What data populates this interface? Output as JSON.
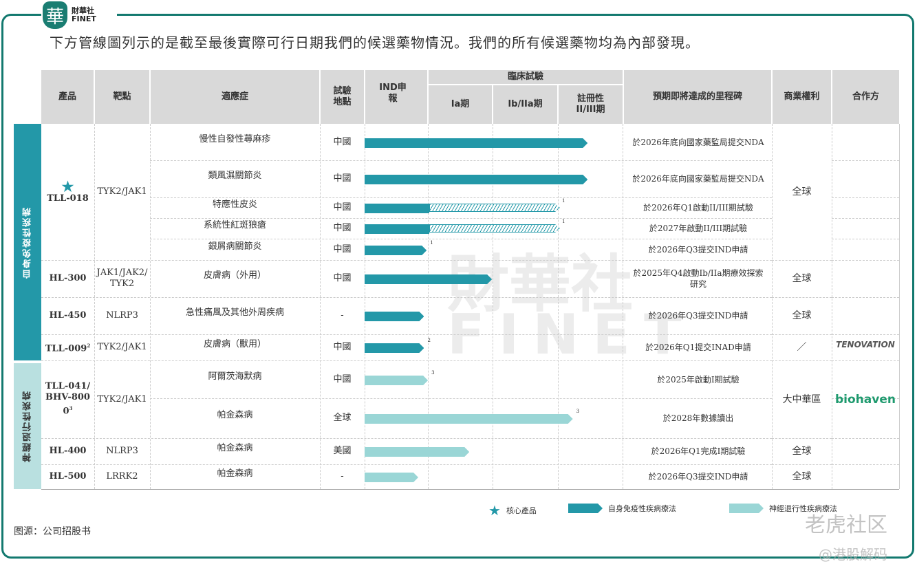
{
  "brand": {
    "logo_char": "華",
    "name": "財華社",
    "sub": "FINET"
  },
  "intro": "下方管線圖列示的是截至最後實際可行日期我們的候選藥物情況。我們的所有候選藥物均為內部發現。",
  "header": {
    "product": "產品",
    "target": "靶點",
    "indication": "適應症",
    "site": "試驗地點",
    "ind": "IND申報",
    "clinical": "臨床試驗",
    "ia": "Ia期",
    "ib": "Ib/IIa期",
    "reg": "註冊性II/III期",
    "milestone": "預期即將達成的里程碑",
    "rights": "商業權利",
    "partner": "合作方"
  },
  "colors": {
    "autoimmune": "#2398a8",
    "neuro": "#9ad6d6"
  },
  "categories": [
    {
      "label": "自身免疫性疾病"
    },
    {
      "label": "神經退行性疾病"
    }
  ],
  "products": [
    {
      "name": "TLL-018",
      "target": "TYK2/JAK1",
      "core": true
    },
    {
      "name": "HL-300",
      "target": "JAK1/JAK2/ TYK2"
    },
    {
      "name": "HL-450",
      "target": "NLRP3"
    },
    {
      "name": "TLL-009",
      "sup": "2",
      "target": "TYK2/JAK1"
    },
    {
      "name": "TLL-041/BHV-8000",
      "sup": "3",
      "target": "TYK2/JAK1"
    },
    {
      "name": "HL-400",
      "target": "NLRP3"
    },
    {
      "name": "HL-500",
      "target": "LRRK2"
    }
  ],
  "rows": [
    {
      "indication": "慢性自發性蕁麻疹",
      "site": "中國",
      "progress_phases": 3.45,
      "type": "auto",
      "milestone": "於2026年底向國家藥監局提交NDA"
    },
    {
      "indication": "類風濕關節炎",
      "site": "中國",
      "progress_phases": 3.45,
      "type": "auto",
      "milestone": "於2026年底向國家藥監局提交NDA"
    },
    {
      "indication": "特應性皮炎",
      "site": "中國",
      "progress_phases": 1.0,
      "planned_to": 3.0,
      "type": "auto",
      "note": "1",
      "milestone": "於2026年Q1啟動II/III期試驗"
    },
    {
      "indication": "系統性紅斑狼瘡",
      "site": "中國",
      "progress_phases": 1.0,
      "planned_to": 3.0,
      "type": "auto",
      "note": "1",
      "milestone": "於2027年啟動II/III期試驗"
    },
    {
      "indication": "銀屑病關節炎",
      "site": "中國",
      "progress_phases": 0.96,
      "type": "auto",
      "note": "1",
      "milestone": "於2026年Q3提交IND申請"
    },
    {
      "indication": "皮膚病（外用）",
      "site": "中國",
      "progress_phases": 1.97,
      "type": "auto",
      "milestone": "於2025年Q4啟動Ib/IIa期療效探索研究"
    },
    {
      "indication": "急性痛風及其他外周疾病",
      "site": "-",
      "progress_phases": 0.92,
      "type": "auto",
      "milestone": "於2026年Q3提交IND申請"
    },
    {
      "indication": "皮膚病（獸用）",
      "site": "中國",
      "progress_phases": 0.92,
      "type": "auto",
      "note": "2",
      "milestone": "於2026年Q1提交INAD申請"
    },
    {
      "indication": "阿爾茨海默病",
      "site": "中國",
      "progress_phases": 0.98,
      "type": "neuro",
      "note": "3",
      "milestone": "於2025年啟動I期試驗"
    },
    {
      "indication": "帕金森病",
      "site": "全球",
      "progress_phases": 3.22,
      "type": "neuro",
      "note": "3",
      "milestone": "於2028年數據讀出"
    },
    {
      "indication": "帕金森病",
      "site": "美國",
      "progress_phases": 1.62,
      "type": "neuro",
      "milestone": "於2026年Q1完成I期試驗"
    },
    {
      "indication": "帕金森病",
      "site": "-",
      "progress_phases": 0.83,
      "type": "neuro",
      "milestone": "於2026年Q3提交IND申請"
    }
  ],
  "rights": [
    "全球",
    "全球",
    "全球",
    "／",
    "大中華區",
    "全球",
    "全球"
  ],
  "partners": [
    "TENOVATION",
    "biohaven"
  ],
  "legend": {
    "core": "核心產品",
    "auto": "自身免疫性疾病療法",
    "neuro": "神經退行性疾病療法"
  },
  "source": "图源：公司招股书",
  "watermarks": {
    "center_cn": "財華社",
    "center_en": "FINET",
    "corner1": "老虎社区",
    "corner2": "@港股解码"
  }
}
